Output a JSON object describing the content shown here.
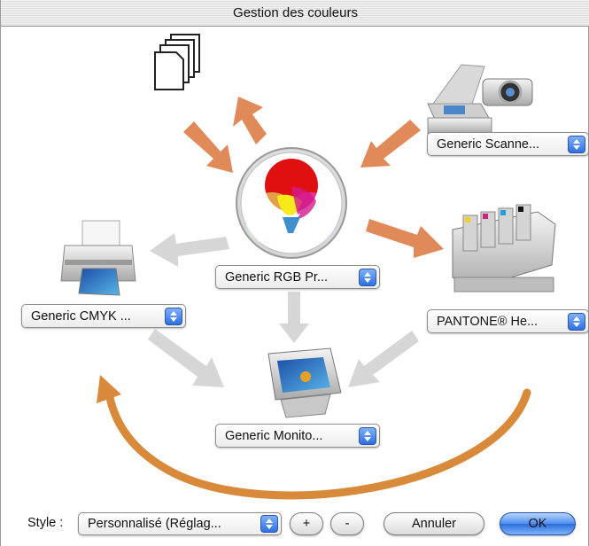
{
  "window": {
    "title": "Gestion des couleurs"
  },
  "devices": {
    "scanner": {
      "label": "Generic Scanne..."
    },
    "rgb": {
      "label": "Generic RGB Pr..."
    },
    "cmyk": {
      "label": "Generic CMYK ..."
    },
    "pantone": {
      "label": "PANTONE® He..."
    },
    "monitor": {
      "label": "Generic Monito..."
    }
  },
  "footer": {
    "style_label": "Style :",
    "style_value": "Personnalisé (Réglag...",
    "plus_label": "+",
    "minus_label": "-",
    "cancel_label": "Annuler",
    "ok_label": "OK"
  },
  "colors": {
    "arrow_orange": "#e08a5a",
    "arrow_grey": "#d6d6d6",
    "curve_orange": "#d8893a",
    "accent_blue": "#2f6fe0"
  },
  "icons": [
    "documents-icon",
    "scanner-camera-icon",
    "rgb-color-wheel-icon",
    "printer-icon",
    "press-icon",
    "monitor-icon"
  ]
}
